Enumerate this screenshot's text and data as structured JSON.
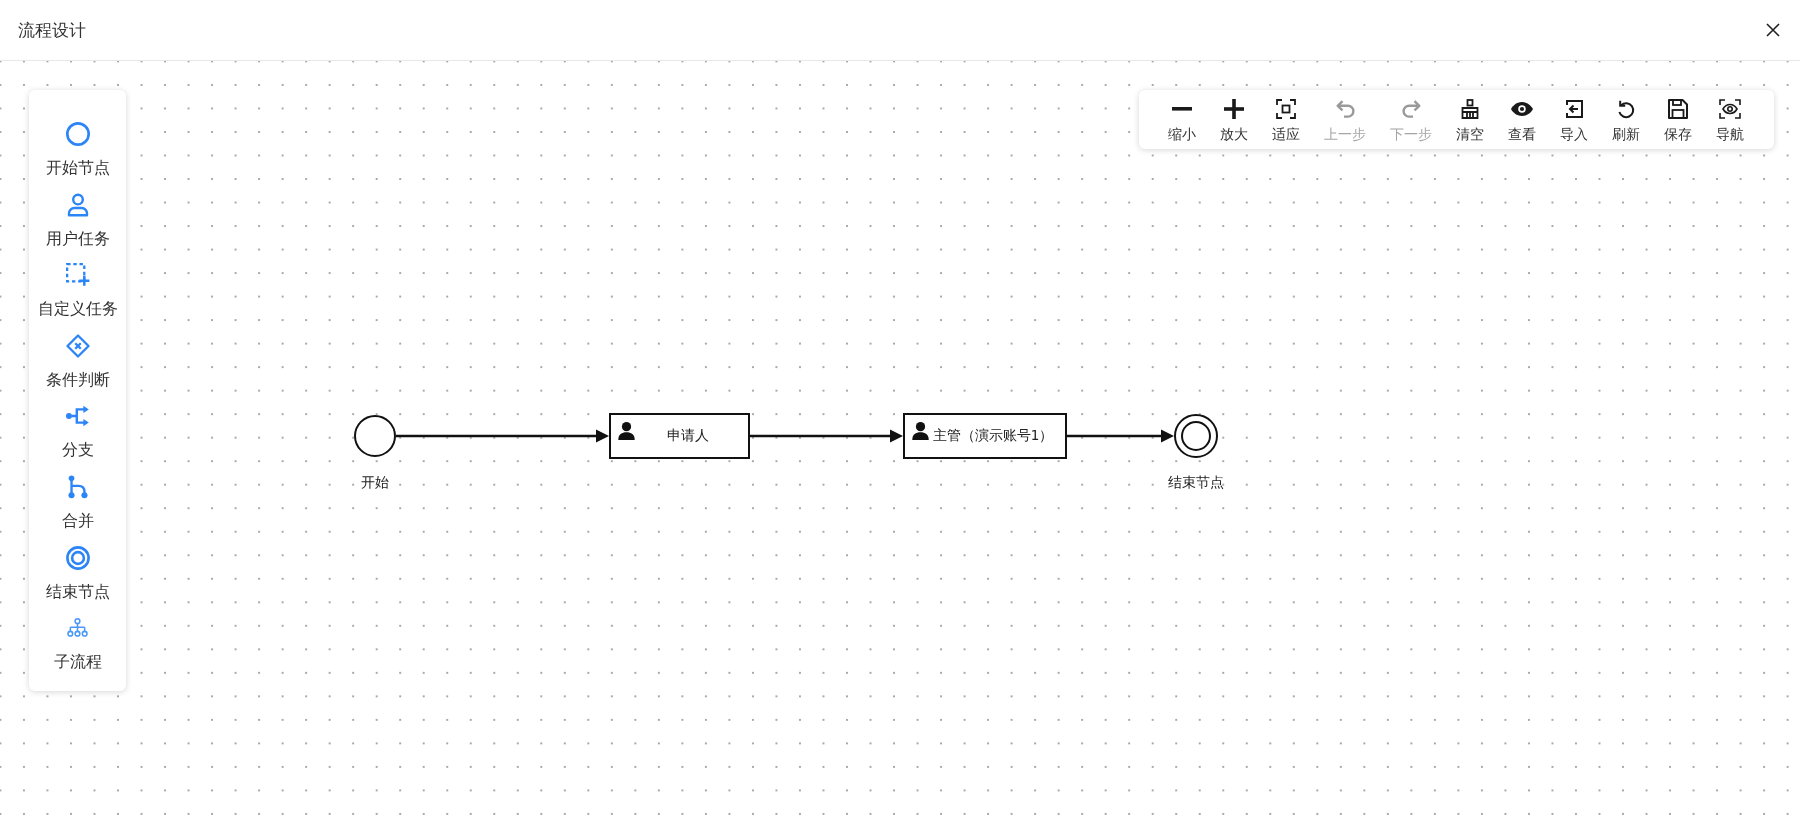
{
  "dialog": {
    "title": "流程设计"
  },
  "palette": {
    "items": [
      {
        "kind": "start-event",
        "label": "开始节点"
      },
      {
        "kind": "user-task",
        "label": "用户任务"
      },
      {
        "kind": "custom-task",
        "label": "自定义任务"
      },
      {
        "kind": "gateway",
        "label": "条件判断"
      },
      {
        "kind": "fork",
        "label": "分支"
      },
      {
        "kind": "join",
        "label": "合并"
      },
      {
        "kind": "end-event",
        "label": "结束节点"
      },
      {
        "kind": "subprocess",
        "label": "子流程"
      }
    ]
  },
  "toolbar": {
    "buttons": [
      {
        "kind": "zoom-out",
        "label": "缩小",
        "disabled": false
      },
      {
        "kind": "zoom-in",
        "label": "放大",
        "disabled": false
      },
      {
        "kind": "fit",
        "label": "适应",
        "disabled": false
      },
      {
        "kind": "undo",
        "label": "上一步",
        "disabled": true
      },
      {
        "kind": "redo",
        "label": "下一步",
        "disabled": true
      },
      {
        "kind": "clear",
        "label": "清空",
        "disabled": false
      },
      {
        "kind": "view",
        "label": "查看",
        "disabled": false
      },
      {
        "kind": "import",
        "label": "导入",
        "disabled": false
      },
      {
        "kind": "refresh",
        "label": "刷新",
        "disabled": false
      },
      {
        "kind": "save",
        "label": "保存",
        "disabled": false
      },
      {
        "kind": "navigate",
        "label": "导航",
        "disabled": false
      }
    ]
  },
  "diagram": {
    "nodes": [
      {
        "kind": "start-event",
        "label": "开始"
      },
      {
        "kind": "user-task",
        "label": "申请人"
      },
      {
        "kind": "user-task",
        "label": "主管（演示账号1）"
      },
      {
        "kind": "end-event",
        "label": "结束节点"
      }
    ]
  }
}
